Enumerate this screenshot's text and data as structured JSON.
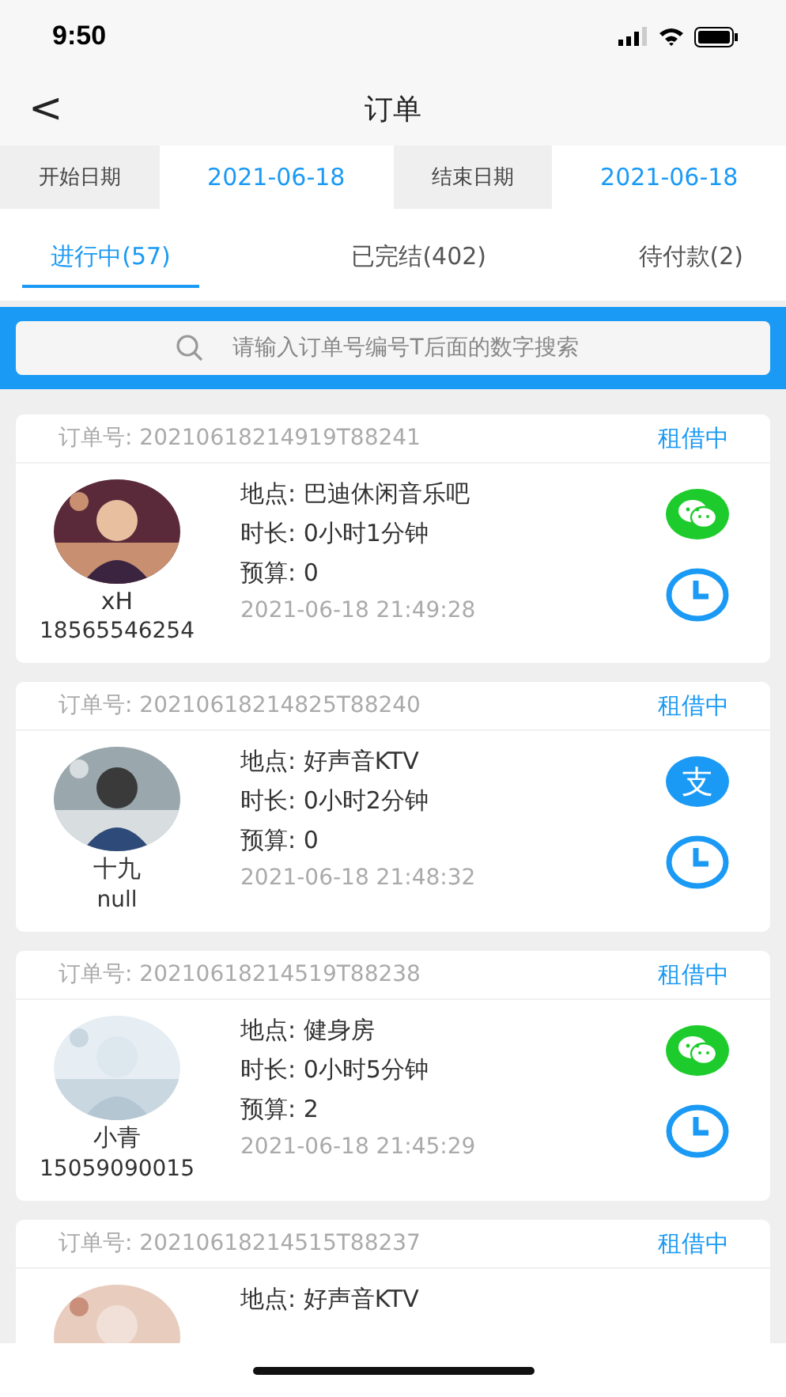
{
  "status_bar": {
    "time": "9:50"
  },
  "nav": {
    "back": "<",
    "title": "订单"
  },
  "date_filter": {
    "start_label": "开始日期",
    "start_value": "2021-06-18",
    "end_label": "结束日期",
    "end_value": "2021-06-18"
  },
  "tabs": [
    {
      "label": "进行中(57)",
      "selected": true
    },
    {
      "label": "已完结(402)",
      "selected": false
    },
    {
      "label": "待付款(2)",
      "selected": false
    }
  ],
  "search": {
    "placeholder": "请输入订单号编号T后面的数字搜索"
  },
  "orders": [
    {
      "order_label": "订单号:",
      "order_no": "20210618214919T88241",
      "status": "租借中",
      "name": "xH",
      "phone": "18565546254",
      "location_label": "地点:",
      "location": "巴迪休闲音乐吧",
      "duration_label": "时长:",
      "duration": "0小时1分钟",
      "budget_label": "预算:",
      "budget": "0",
      "time": "2021-06-18 21:49:28",
      "payment": {
        "kind": "wechat"
      }
    },
    {
      "order_label": "订单号:",
      "order_no": "20210618214825T88240",
      "status": "租借中",
      "name": "十九",
      "phone": "null",
      "location_label": "地点:",
      "location": "好声音KTV",
      "duration_label": "时长:",
      "duration": "0小时2分钟",
      "budget_label": "预算:",
      "budget": "0",
      "time": "2021-06-18 21:48:32",
      "payment": {
        "kind": "alipay",
        "glyph": "支"
      }
    },
    {
      "order_label": "订单号:",
      "order_no": "20210618214519T88238",
      "status": "租借中",
      "name": "小青",
      "phone": "15059090015",
      "location_label": "地点:",
      "location": "健身房",
      "duration_label": "时长:",
      "duration": "0小时5分钟",
      "budget_label": "预算:",
      "budget": "2",
      "time": "2021-06-18 21:45:29",
      "payment": {
        "kind": "wechat"
      }
    },
    {
      "order_label": "订单号:",
      "order_no": "20210618214515T88237",
      "status": "租借中",
      "location_label": "地点:",
      "location": "好声音KTV"
    }
  ]
}
